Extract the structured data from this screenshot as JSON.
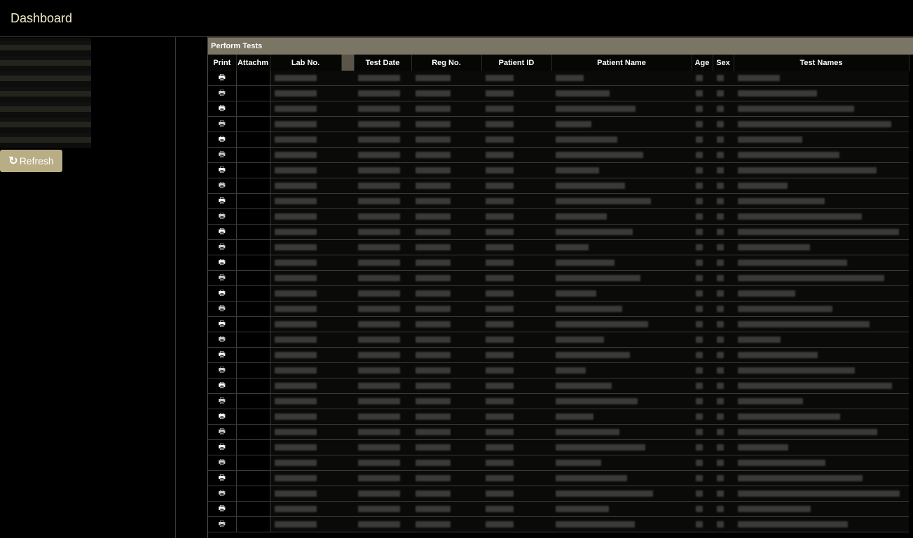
{
  "header": {
    "title": "Dashboard"
  },
  "sidebar": {
    "refresh_label": "Refresh"
  },
  "panel": {
    "title": "Perform Tests",
    "columns": [
      "Print",
      "Attachm",
      "Lab No.",
      "",
      "Test Date",
      "Reg No.",
      "Patient ID",
      "Patient Name",
      "Age",
      "Sex",
      "Test Names"
    ],
    "row_count": 30
  }
}
